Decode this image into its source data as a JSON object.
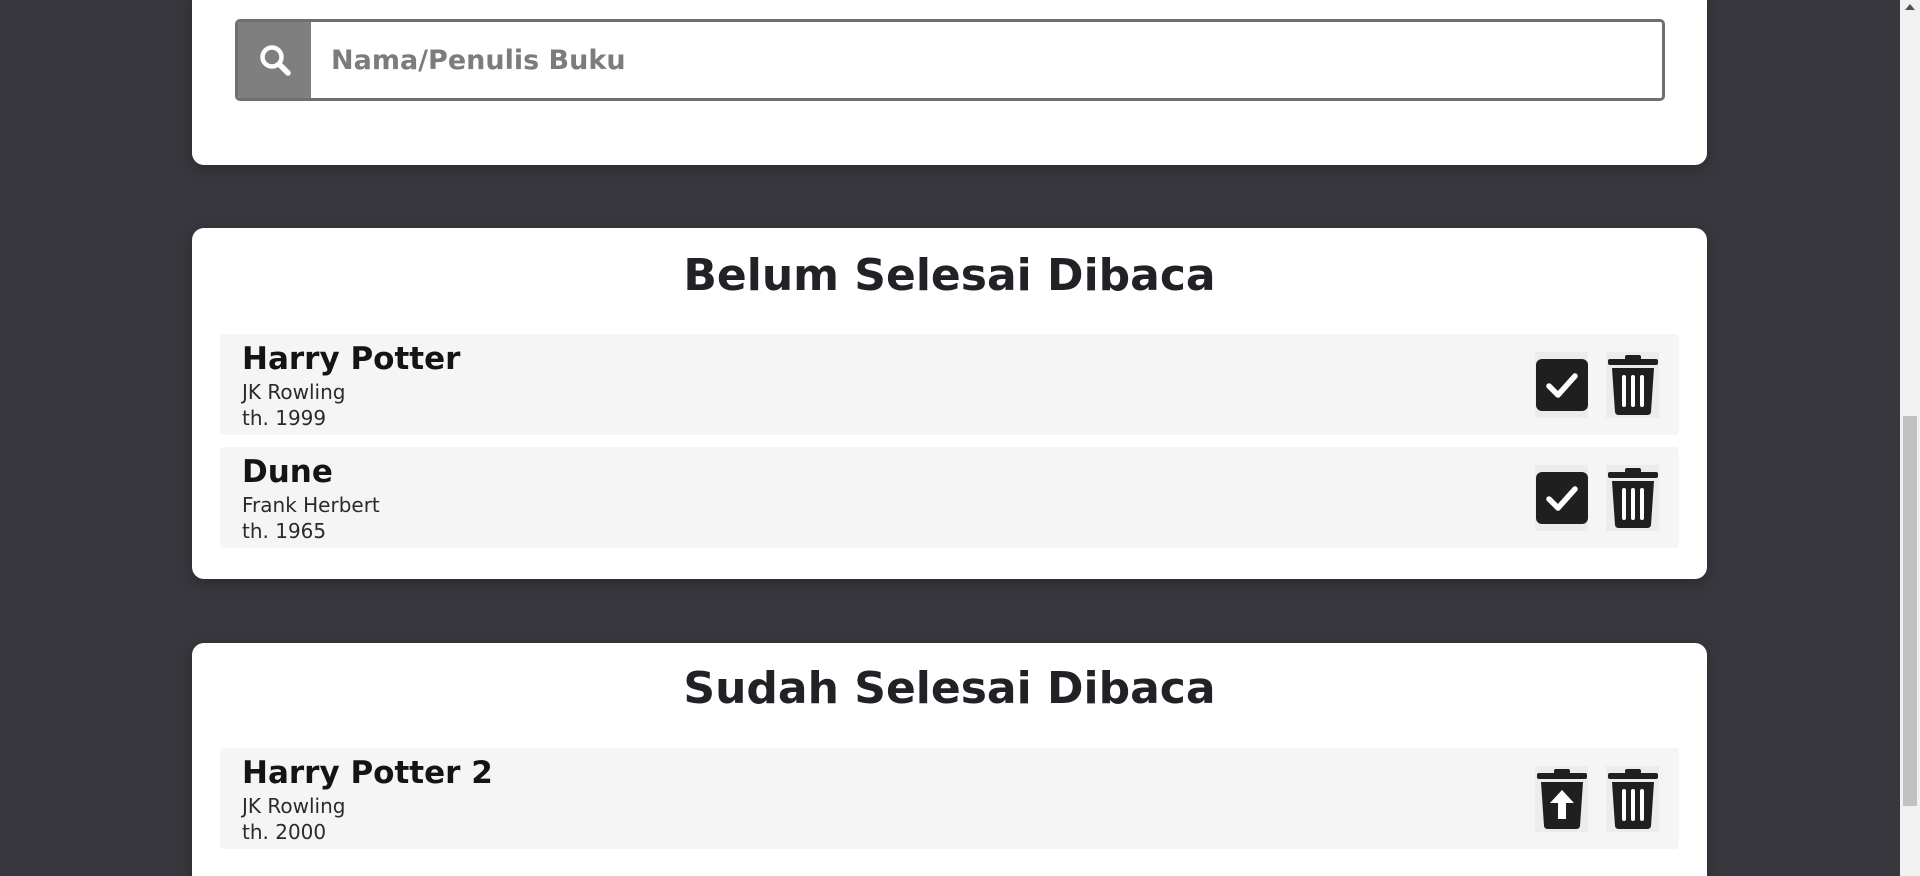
{
  "search": {
    "placeholder": "Nama/Penulis Buku",
    "value": ""
  },
  "unread_section": {
    "title": "Belum Selesai Dibaca",
    "books": [
      {
        "title": "Harry Potter",
        "author": "JK Rowling",
        "year": "th. 1999"
      },
      {
        "title": "Dune",
        "author": "Frank Herbert",
        "year": "th. 1965"
      }
    ]
  },
  "read_section": {
    "title": "Sudah Selesai Dibaca",
    "books": [
      {
        "title": "Harry Potter 2",
        "author": "JK Rowling",
        "year": "th. 2000"
      }
    ]
  },
  "icons": {
    "search": "search-icon",
    "mark_read": "check-square-icon",
    "move_back": "undo-trash-icon",
    "delete": "trash-icon"
  },
  "colors": {
    "background": "#38373d",
    "card": "#ffffff",
    "item": "#f5f5f5",
    "icon": "#1f1f1f",
    "search_button": "#7f7f7f"
  }
}
